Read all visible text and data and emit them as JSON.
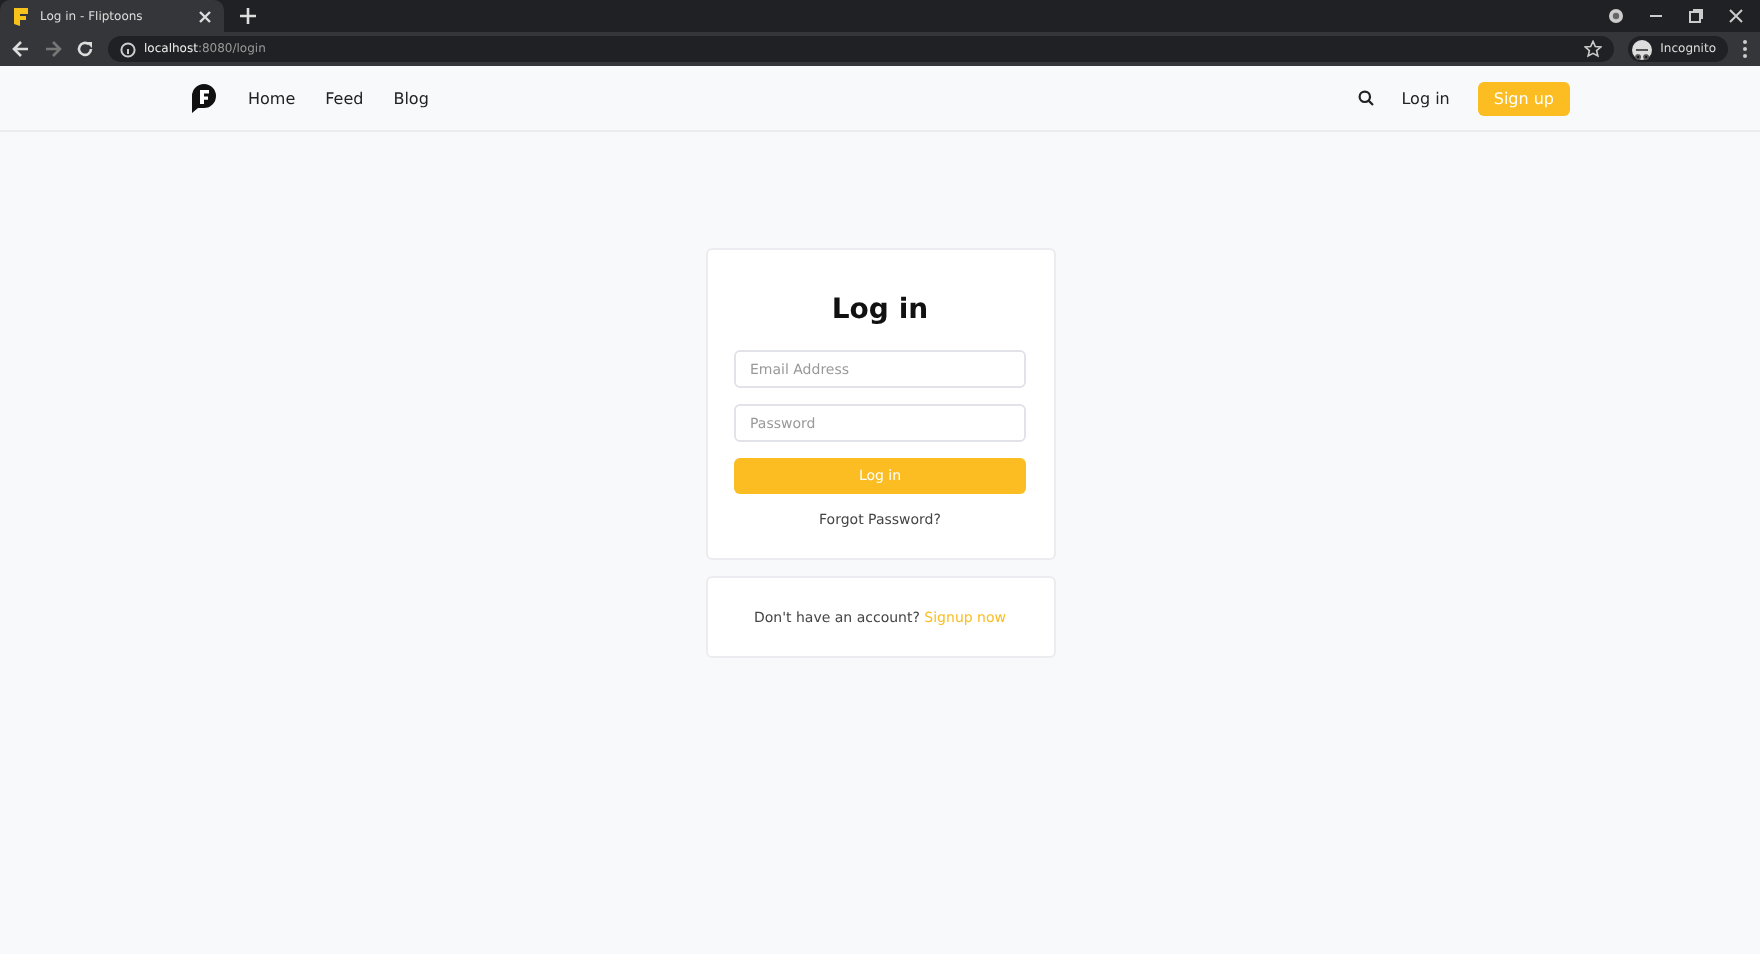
{
  "browser": {
    "tab_title": "Log in - Fliptoons",
    "address_host": "localhost",
    "address_path": ":8080/login",
    "profile": "Incognito"
  },
  "nav": {
    "links": [
      "Home",
      "Feed",
      "Blog"
    ],
    "login": "Log in",
    "signup": "Sign up"
  },
  "login_card": {
    "title": "Log in",
    "email_placeholder": "Email Address",
    "password_placeholder": "Password",
    "submit": "Log in",
    "forgot": "Forgot Password?"
  },
  "signup_card": {
    "prompt": "Don't have an account?",
    "link": "Signup now"
  }
}
